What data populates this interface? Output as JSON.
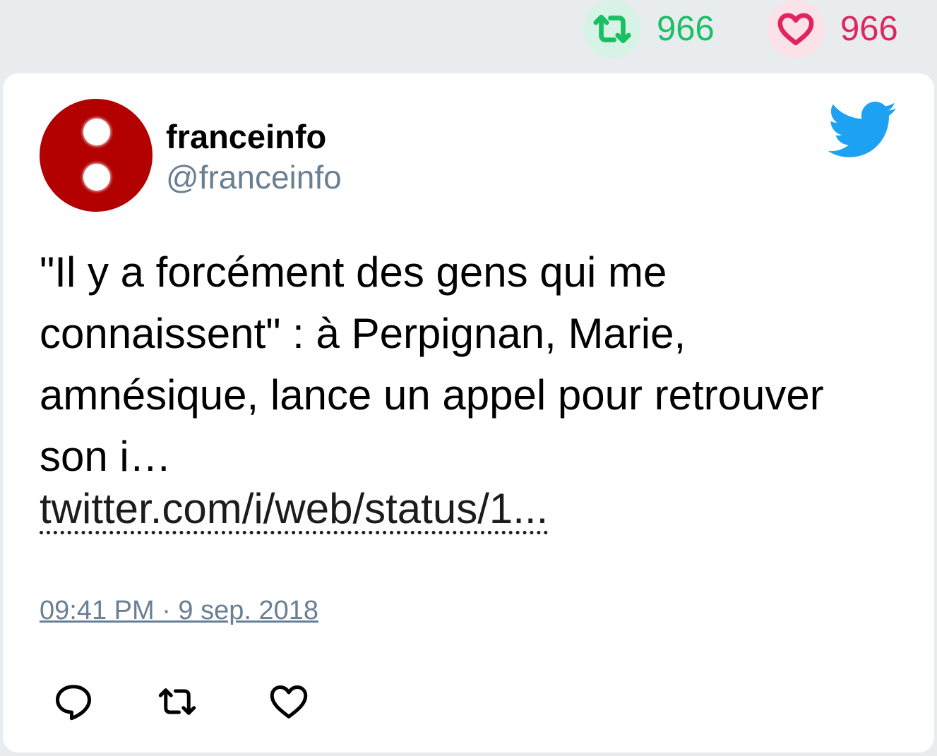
{
  "stats": {
    "retweets": "966",
    "likes": "966",
    "retweet_color": "#19bf63",
    "like_color": "#e0245e"
  },
  "tweet": {
    "author_name": "franceinfo",
    "author_handle": "@franceinfo",
    "text": "\"Il y a forcément des gens qui me connaissent\" : à Perpignan, Marie, amnésique, lance un appel pour retrouver son i…",
    "link": "twitter.com/i/web/status/1...",
    "timestamp": "09:41 PM · 9 sep. 2018"
  },
  "icons": {
    "brand": "twitter-bird-icon",
    "actions": [
      "reply-icon",
      "retweet-icon",
      "like-icon"
    ],
    "brand_color": "#1da1f2",
    "avatar_color": "#b30000"
  }
}
